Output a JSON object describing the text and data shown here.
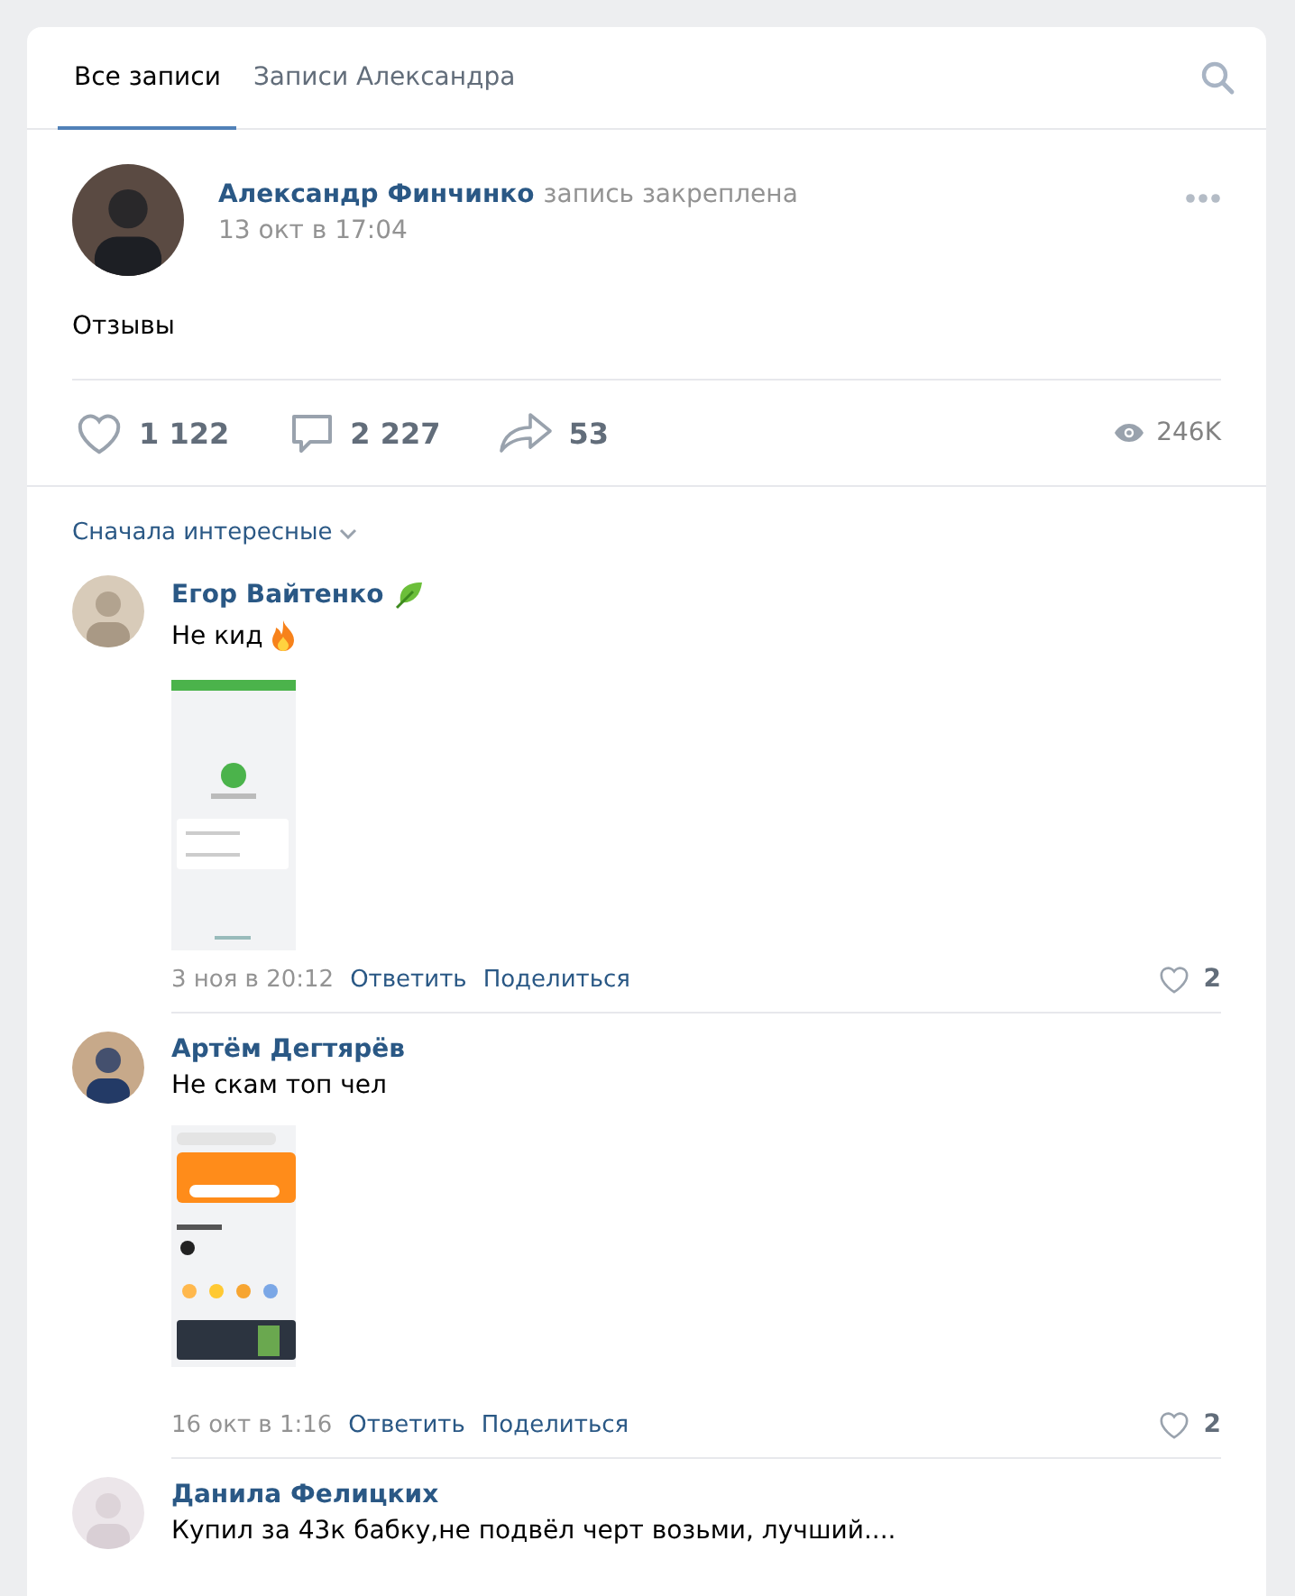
{
  "tabs": [
    {
      "label": "Все записи",
      "selected": true
    },
    {
      "label": "Записи Александра",
      "selected": false
    }
  ],
  "post": {
    "author": "Александр Финчинко",
    "status": "запись закреплена",
    "date": "13 окт в 17:04",
    "text": "Отзывы",
    "likes": "1 122",
    "comments": "2 227",
    "shares": "53",
    "views": "246K"
  },
  "sort": {
    "label": "Сначала интересные"
  },
  "comments": [
    {
      "author": "Егор Вайтенко",
      "leaf_badge": true,
      "text": "Не кид",
      "fire_emoji": true,
      "date": "3 ноя в 20:12",
      "reply": "Ответить",
      "share": "Поделиться",
      "likes": "2"
    },
    {
      "author": "Артём Дегтярёв",
      "text": "Не скам топ чел",
      "date": "16 окт в 1:16",
      "reply": "Ответить",
      "share": "Поделиться",
      "likes": "2"
    },
    {
      "author": "Данила Фелицких",
      "text": "Купил за 43к бабку,не подвёл черт возьми, лучший...."
    }
  ]
}
